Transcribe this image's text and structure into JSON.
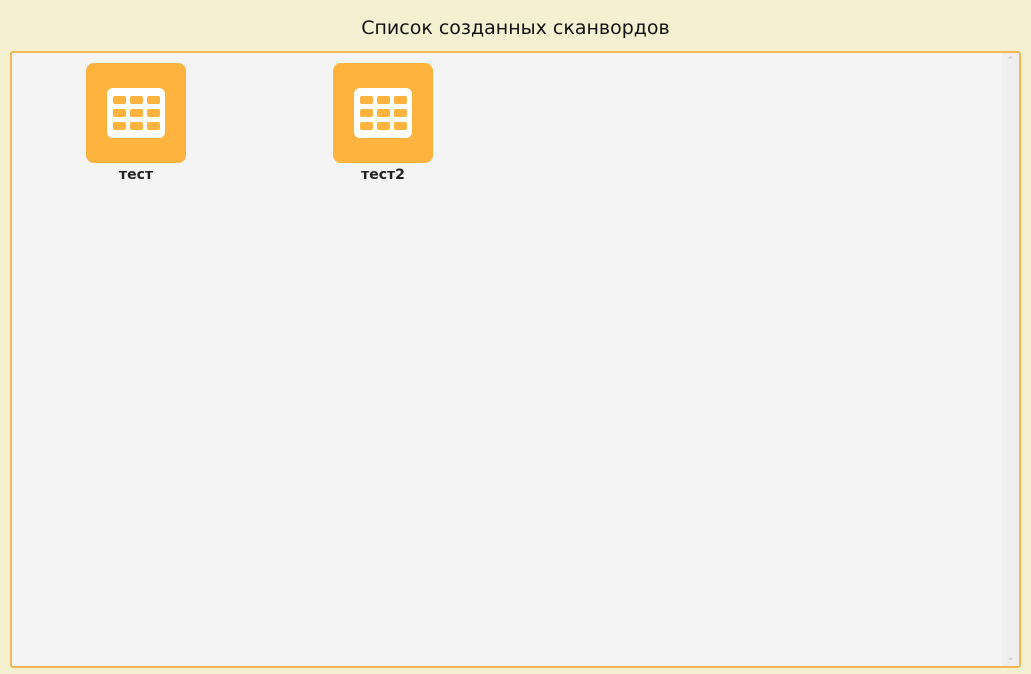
{
  "header": {
    "title": "Список созданных сканвордов"
  },
  "items": [
    {
      "label": "тест",
      "icon": "table-grid-icon"
    },
    {
      "label": "тест2",
      "icon": "table-grid-icon"
    }
  ],
  "scrollbar": {
    "up_glyph": "⌃",
    "down_glyph": "⌄"
  },
  "colors": {
    "background": "#f6f0d2",
    "panel_border": "#f6b651",
    "panel_background": "#f4f4f4",
    "tile": "#fdb33e",
    "icon": "#ffffff"
  }
}
